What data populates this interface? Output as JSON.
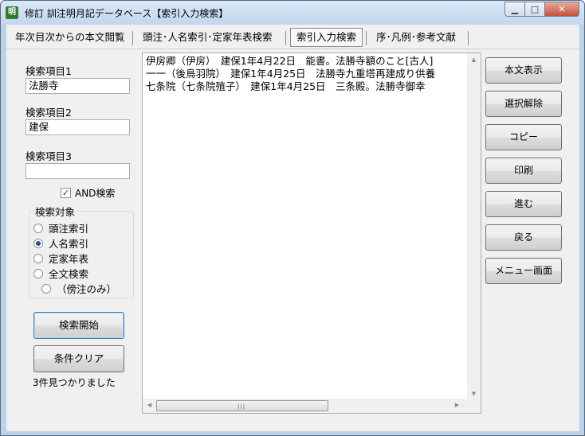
{
  "window": {
    "title": "修訂 訓注明月記データベース【索引入力検索】",
    "icon_glyph": "明",
    "minimize_glyph": "▁",
    "maximize_glyph": "□",
    "close_glyph": "✕"
  },
  "tabs": [
    {
      "label": "年次目次からの本文閲覧"
    },
    {
      "label": "頭注･人名索引･定家年表検索"
    },
    {
      "label": "索引入力検索"
    },
    {
      "label": "序･凡例･参考文献"
    }
  ],
  "search": {
    "item1_label": "検索項目1",
    "item1_value": "法勝寺",
    "item2_label": "検索項目2",
    "item2_value": "建保",
    "item3_label": "検索項目3",
    "item3_value": "",
    "and_label": "AND検索",
    "and_checked": true,
    "check_glyph": "✓"
  },
  "target": {
    "title": "検索対象",
    "options": [
      {
        "label": "頭注索引",
        "selected": false
      },
      {
        "label": "人名索引",
        "selected": true
      },
      {
        "label": "定家年表",
        "selected": false
      },
      {
        "label": "全文検索",
        "selected": false
      },
      {
        "label": "（傍注のみ）",
        "selected": false
      }
    ]
  },
  "actions": {
    "start_label": "検索開始",
    "clear_label": "条件クリア",
    "status": "3件見つかりました"
  },
  "results": [
    "伊房卿（伊房）　建保1年4月22日　能書。法勝寺額のこと[古人]",
    "一一（後鳥羽院）　建保1年4月25日　法勝寺九重塔再建成り供養",
    "七条院（七条院殖子）　建保1年4月25日　三条殿。法勝寺御幸"
  ],
  "scrollbar": {
    "up_glyph": "▲",
    "down_glyph": "▼",
    "left_glyph": "◀",
    "right_glyph": "▶",
    "grip_glyph": "|||"
  },
  "side_buttons": [
    {
      "label": "本文表示"
    },
    {
      "label": "選択解除"
    },
    {
      "label": "コピー"
    },
    {
      "label": "印刷"
    },
    {
      "label": "進む"
    },
    {
      "label": "戻る"
    },
    {
      "label": "メニュー画面"
    }
  ]
}
